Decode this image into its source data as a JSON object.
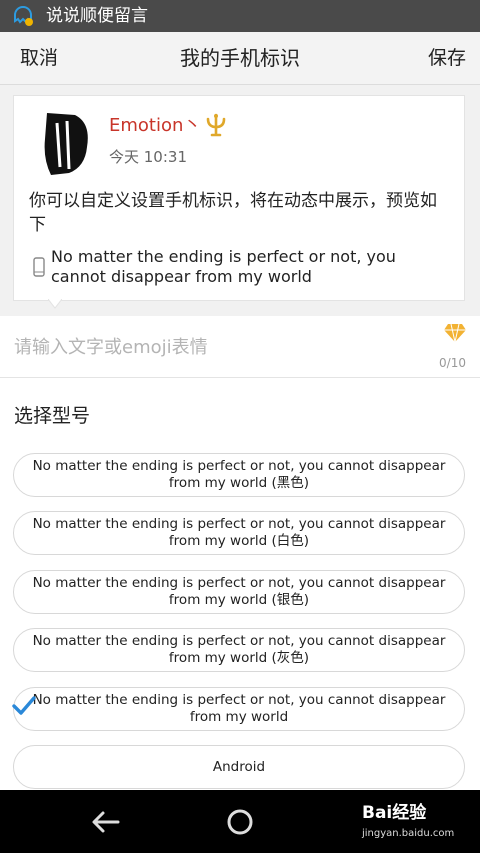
{
  "statusbar": {
    "title": "说说顺便留言"
  },
  "navbar": {
    "left_label": "取消",
    "title": "我的手机标识",
    "right_label": "保存"
  },
  "preview": {
    "nickname": "Emotion丶",
    "time": "今天 10:31",
    "text": "你可以自定义设置手机标识，将在动态中展示，预览如下",
    "device_label": "No matter the ending is perfect or not, you cannot disappear from my world"
  },
  "input": {
    "placeholder": "请输入文字或emoji表情",
    "value": "",
    "count": "0/10"
  },
  "models": {
    "title": "选择型号",
    "options": [
      {
        "label": "No matter the ending is perfect or not, you cannot disappear from my world (黑色)",
        "selected": false
      },
      {
        "label": "No matter the ending is perfect or not, you cannot disappear from my world (白色)",
        "selected": false
      },
      {
        "label": "No matter the ending is perfect or not, you cannot disappear from my world (银色)",
        "selected": false
      },
      {
        "label": "No matter the ending is perfect or not, you cannot disappear from my world (灰色)",
        "selected": false
      },
      {
        "label": "No matter the ending is perfect or not, you cannot disappear from my world",
        "selected": true
      },
      {
        "label": "Android",
        "selected": false
      }
    ]
  },
  "watermark": {
    "logo": "Bai经验",
    "url": "jingyan.baidu.com"
  },
  "colors": {
    "nickname": "#c8352a",
    "check": "#2a88d8",
    "gem": "#f2b233",
    "vip": "#e0a82a"
  },
  "icons": [
    "qq-space-icon",
    "vip-badge-icon",
    "phone-icon",
    "gem-icon",
    "check-icon",
    "back-icon",
    "home-icon"
  ]
}
